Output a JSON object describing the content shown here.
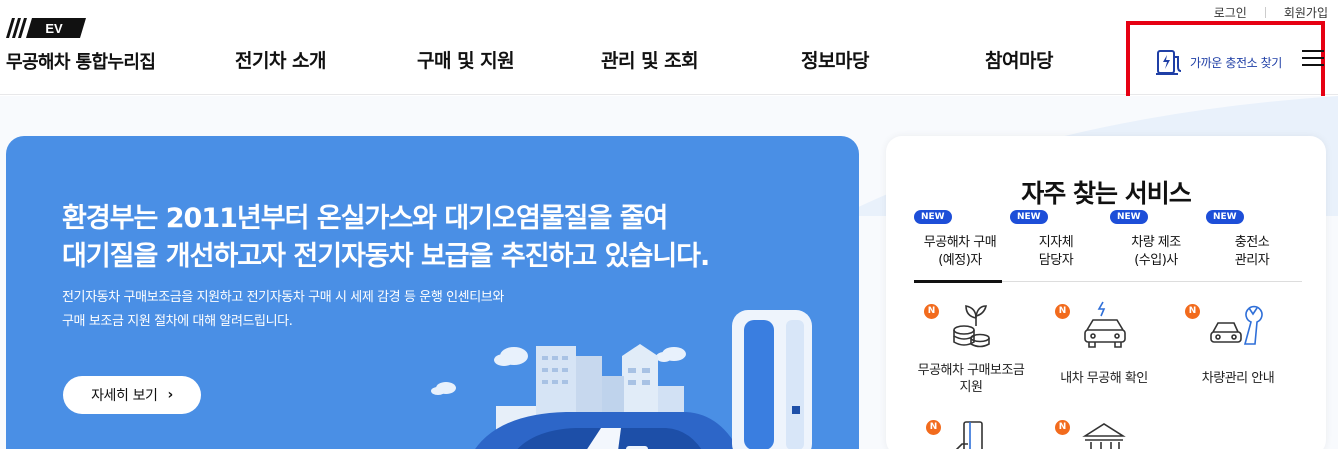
{
  "header": {
    "logo_badge": "EV",
    "logo_text": "무공해차 통합누리집",
    "util": {
      "login": "로그인",
      "signup": "회원가입"
    },
    "nav": [
      "전기차 소개",
      "구매 및 지원",
      "관리 및 조회",
      "정보마당",
      "참여마당"
    ],
    "charger_label": "가까운 충전소 찾기",
    "highlight_color": "#e60012"
  },
  "hero": {
    "title_line1": "환경부는 2011년부터 온실가스와 대기오염물질을 줄여",
    "title_line2": "대기질을 개선하고자 전기자동차 보급을 추진하고 있습니다.",
    "desc_line1": "전기자동차 구매보조금을 지원하고 전기자동차 구매 시 세제 감경 등 운행 인센티브와",
    "desc_line2": "구매 보조금 지원 절차에 대해 알려드립니다.",
    "button_label": "자세히 보기",
    "bg_color": "#4a8fe5"
  },
  "services": {
    "title": "자주 찾는 서비스",
    "tabs": [
      {
        "badge": "NEW",
        "label": "무공해차 구매\n(예정)자"
      },
      {
        "badge": "NEW",
        "label": "지자체\n담당자"
      },
      {
        "badge": "NEW",
        "label": "차량 제조\n(수입)사"
      },
      {
        "badge": "NEW",
        "label": "충전소\n관리자"
      }
    ],
    "items": [
      {
        "badge": "N",
        "label": "무공해차 구매보조금\n지원",
        "icon": "coins-plant-icon"
      },
      {
        "badge": "N",
        "label": "내차 무공해 확인",
        "icon": "ev-car-icon"
      },
      {
        "badge": "N",
        "label": "차량관리 안내",
        "icon": "car-wrench-icon"
      },
      {
        "badge": "N",
        "label": "",
        "icon": "card-hand-icon"
      },
      {
        "badge": "N",
        "label": "",
        "icon": "institution-icon"
      }
    ]
  }
}
